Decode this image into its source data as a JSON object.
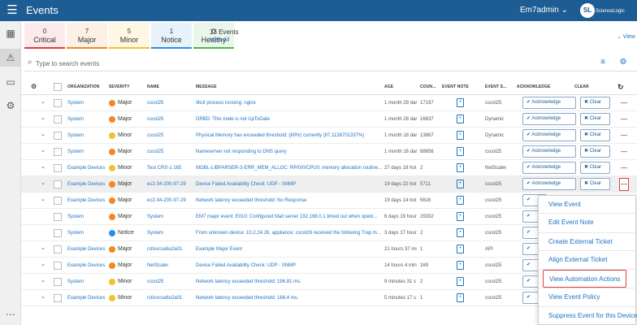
{
  "header": {
    "title": "Events",
    "user": "Em7admin ⌄",
    "logo_mark": "SL",
    "logo_text": "ScienceLogic"
  },
  "summary": {
    "cards": [
      {
        "count": "0",
        "label": "Critical",
        "color": "#e8383a",
        "bg": "#fdeaea"
      },
      {
        "count": "7",
        "label": "Major",
        "color": "#f08a24",
        "bg": "#fdf0e4"
      },
      {
        "count": "5",
        "label": "Minor",
        "color": "#f4c02b",
        "bg": "#fdf7e3"
      },
      {
        "count": "1",
        "label": "Notice",
        "color": "#2c8de8",
        "bg": "#e7f2fd"
      },
      {
        "count": "0",
        "label": "Healthy",
        "color": "#4bb84b",
        "bg": "#eaf6ea"
      }
    ],
    "total": "13 Events",
    "view_all": "View All",
    "view": "⌄ View"
  },
  "search": {
    "placeholder": "Type to search events"
  },
  "columns": {
    "organization": "ORGANIZATION",
    "severity": "SEVERITY",
    "name": "NAME",
    "message": "MESSAGE",
    "age": "AGE",
    "count": "COUN...",
    "event_note": "EVENT NOTE",
    "event_source": "EVENT S...",
    "acknowledge": "ACKNOWLEDGE",
    "clear": "CLEAR"
  },
  "buttons": {
    "acknowledge": "✔ Acknowledge",
    "clear": "✖ Clear"
  },
  "severity_colors": {
    "Major": "#f08a24",
    "Minor": "#f4c02b",
    "Notice": "#2c8de8"
  },
  "rows": [
    {
      "expand": true,
      "org": "System",
      "severity": "Major",
      "name": "cscol25",
      "message": "Illicit process running: nginx",
      "age": "1 month 29 dar",
      "count": "17197",
      "source": "cscol25",
      "ack": true
    },
    {
      "expand": true,
      "org": "System",
      "severity": "Major",
      "name": "cscol25",
      "message": "DRBD: This node is not UpToDate",
      "age": "1 month 28 dar",
      "count": "16837",
      "source": "Dynamic",
      "ack": true
    },
    {
      "expand": true,
      "org": "System",
      "severity": "Minor",
      "name": "cscol25",
      "message": "Physical Memory has exceeded threshold: (80%) currently (87.1138701337%)",
      "age": "1 month 18 dar",
      "count": "13867",
      "source": "Dynamic",
      "ack": true
    },
    {
      "expand": true,
      "org": "System",
      "severity": "Major",
      "name": "cscol25",
      "message": "Nameserver not responding to DNS query",
      "age": "1 month 16 dar",
      "count": "68656",
      "source": "cscol25",
      "ack": true
    },
    {
      "expand": true,
      "org": "Example Devices",
      "severity": "Minor",
      "name": "Test CRS-1 165",
      "message": "MGBL-LIBPARSER-3-ERR_MEM_ALLOC: RP/0/0/CPU0: memory allocation routine...",
      "age": "27 days 18 hot",
      "count": "2",
      "source": "NetScaler",
      "ack": true
    },
    {
      "expand": true,
      "org": "Example Devices",
      "severity": "Major",
      "name": "ec2-34-200-97-29",
      "message": "Device Failed Availability Check: UDP - SNMP",
      "age": "19 days 22 hot",
      "count": "5711",
      "source": "cscol25",
      "ack": true,
      "selected": true
    },
    {
      "expand": true,
      "org": "Example Devices",
      "severity": "Major",
      "name": "ec2-34-200-97-29",
      "message": "Network latency exceeded threshold: No Response",
      "age": "19 days 14 hot",
      "count": "5616",
      "source": "cscol25",
      "ack": true
    },
    {
      "expand": false,
      "org": "System",
      "severity": "Major",
      "name": "System",
      "message": "EM7 major event: E010: Configured Mail server 192.168.0.1 timed out when openi...",
      "age": "6 days 19 hour",
      "count": "29332",
      "source": "cscol25",
      "ack": true
    },
    {
      "expand": false,
      "org": "System",
      "severity": "Notice",
      "name": "System",
      "message": "From unknown device: 10.2.24.26, appliance: cscol26 received the following Trap m...",
      "age": "3 days 17 hour",
      "count": "2",
      "source": "cscol25",
      "ack": true
    },
    {
      "expand": true,
      "org": "Example Devices",
      "severity": "Major",
      "name": "rstlsvcsa6u2a01",
      "message": "Example Major Event",
      "age": "21 hours 37 mi",
      "count": "1",
      "source": "API",
      "ack": true
    },
    {
      "expand": true,
      "org": "Example Devices",
      "severity": "Major",
      "name": "NetScaler",
      "message": "Device Failed Availability Check: UDP - SNMP",
      "age": "14 hours 4 min",
      "count": "169",
      "source": "cscol25",
      "ack": true
    },
    {
      "expand": true,
      "org": "System",
      "severity": "Minor",
      "name": "cscol25",
      "message": "Network latency exceeded threshold: 196.81 ms.",
      "age": "9 minutes 31 s",
      "count": "2",
      "source": "cscol25",
      "ack": true
    },
    {
      "expand": true,
      "org": "Example Devices",
      "severity": "Minor",
      "name": "rstlsvcsa6u2a01",
      "message": "Network latency exceeded threshold: 168.4 ms.",
      "age": "5 minutes 17 s",
      "count": "1",
      "source": "cscol25",
      "ack": true
    }
  ],
  "menu": {
    "items": [
      "View Event",
      "Edit Event Note",
      "Create External Ticket",
      "Align External Ticket",
      "View Automation Actions",
      "View Event Policy",
      "Suppress Event for this Device"
    ],
    "highlighted_index": 4
  }
}
